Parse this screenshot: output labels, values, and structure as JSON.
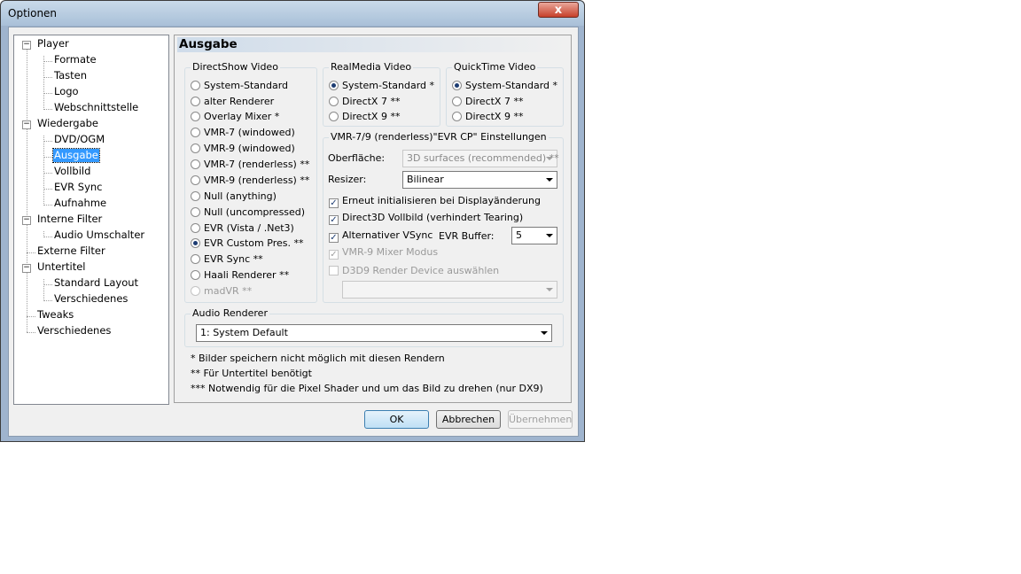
{
  "window": {
    "title": "Optionen",
    "close_label": "x"
  },
  "tree": {
    "items": [
      {
        "label": "Player"
      },
      {
        "label": "Formate"
      },
      {
        "label": "Tasten"
      },
      {
        "label": "Logo"
      },
      {
        "label": "Webschnittstelle"
      },
      {
        "label": "Wiedergabe"
      },
      {
        "label": "DVD/OGM"
      },
      {
        "label": "Ausgabe"
      },
      {
        "label": "Vollbild"
      },
      {
        "label": "EVR Sync"
      },
      {
        "label": "Aufnahme"
      },
      {
        "label": "Interne Filter"
      },
      {
        "label": "Audio Umschalter"
      },
      {
        "label": "Externe Filter"
      },
      {
        "label": "Untertitel"
      },
      {
        "label": "Standard Layout"
      },
      {
        "label": "Verschiedenes"
      },
      {
        "label": "Tweaks"
      },
      {
        "label": "Verschiedenes"
      }
    ],
    "selected": "Ausgabe",
    "expander_minus": "−"
  },
  "page": {
    "title": "Ausgabe",
    "directshow": {
      "legend": "DirectShow Video",
      "options": [
        "System-Standard",
        "alter Renderer",
        "Overlay Mixer *",
        "VMR-7 (windowed)",
        "VMR-9 (windowed)",
        "VMR-7 (renderless) **",
        "VMR-9 (renderless) **",
        "Null (anything)",
        "Null (uncompressed)",
        "EVR (Vista / .Net3)",
        "EVR Custom Pres. **",
        "EVR Sync **",
        "Haali Renderer **",
        "madVR **"
      ],
      "selected": "EVR Custom Pres. **",
      "disabled": "madVR **"
    },
    "realmedia": {
      "legend": "RealMedia Video",
      "options": [
        "System-Standard *",
        "DirectX 7 **",
        "DirectX 9 **"
      ],
      "selected": "System-Standard *"
    },
    "quicktime": {
      "legend": "QuickTime Video",
      "options": [
        "System-Standard *",
        "DirectX 7 **",
        "DirectX 9 **"
      ],
      "selected": "System-Standard *"
    },
    "evr_settings": {
      "legend": "VMR-7/9 (renderless)\"EVR CP\" Einstellungen",
      "surface_label": "Oberfläche:",
      "surface_value": "3D surfaces (recommended) **",
      "resizer_label": "Resizer:",
      "resizer_value": "Bilinear",
      "check_reinit": "Erneut initialisieren bei Displayänderung",
      "check_fullscreen": "Direct3D Vollbild (verhindert Tearing)",
      "check_vsync": "Alternativer VSync",
      "buffer_label": "EVR Buffer:",
      "buffer_value": "5",
      "check_mixer": "VMR-9 Mixer Modus",
      "check_d3d9": "D3D9 Render Device auswählen",
      "device_value": "",
      "checkmark": "✓"
    },
    "audio": {
      "legend": "Audio Renderer",
      "value": "1: System Default"
    },
    "notes": [
      "* Bilder speichern nicht möglich mit diesen Rendern",
      "** Für Untertitel benötigt",
      "*** Notwendig für die Pixel Shader und um das Bild zu drehen (nur DX9)"
    ]
  },
  "buttons": {
    "ok": "OK",
    "cancel": "Abbrechen",
    "apply": "Übernehmen"
  }
}
